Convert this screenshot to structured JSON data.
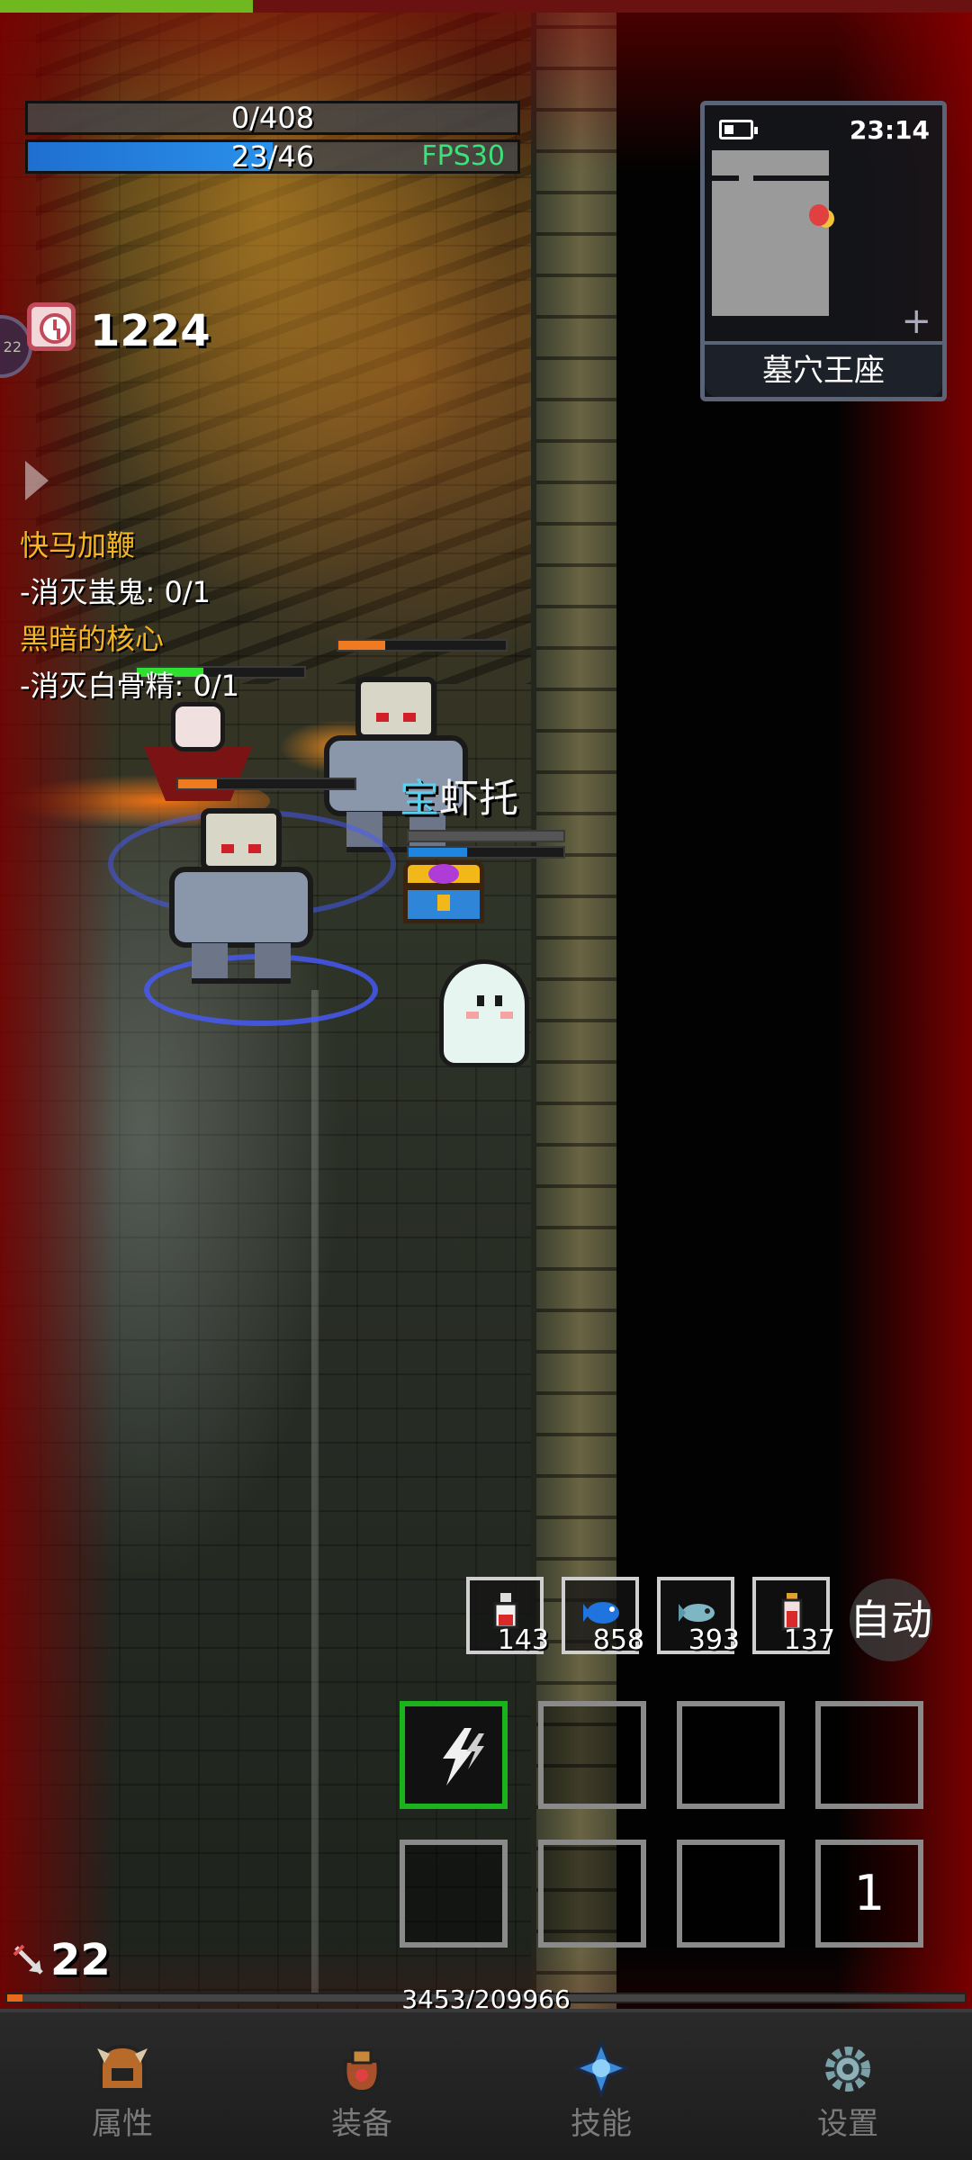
{
  "top_progress": {
    "fraction": 0.26,
    "color": "#6fb81f"
  },
  "hp": {
    "text": "0/408",
    "fraction": 0.0
  },
  "mp": {
    "text": "23/46",
    "fraction": 0.5
  },
  "fps": "FPS30",
  "timer": {
    "value": "1224",
    "icon": "clock-icon"
  },
  "quests": [
    {
      "title": "快马加鞭",
      "task": "-消灭蚩鬼: 0/1"
    },
    {
      "title": "黑暗的核心",
      "task": "-消灭白骨精: 0/1"
    }
  ],
  "minimap": {
    "time": "23:14",
    "area_name": "墓穴王座",
    "battery_icon": "battery-icon",
    "expand_icon": "plus-icon"
  },
  "pet_name": {
    "prefix": "宝",
    "name": "虾托"
  },
  "consumables": [
    {
      "icon": "potion-icon",
      "count": "143"
    },
    {
      "icon": "blue-fish-icon",
      "count": "858"
    },
    {
      "icon": "fish-icon",
      "count": "393"
    },
    {
      "icon": "red-potion-icon",
      "count": "137"
    }
  ],
  "auto_button": "自动",
  "skills": [
    {
      "icon": "lightning-bolt-icon",
      "active": true,
      "count": ""
    },
    {
      "icon": "",
      "active": false,
      "count": ""
    },
    {
      "icon": "",
      "active": false,
      "count": ""
    },
    {
      "icon": "",
      "active": false,
      "count": ""
    },
    {
      "icon": "",
      "active": false,
      "count": ""
    },
    {
      "icon": "",
      "active": false,
      "count": ""
    },
    {
      "icon": "",
      "active": false,
      "count": ""
    },
    {
      "icon": "",
      "active": false,
      "count": "1"
    }
  ],
  "arrows": {
    "icon": "arrow-icon",
    "count": "22"
  },
  "experience": {
    "text": "3453/209966",
    "fraction": 0.016
  },
  "nav": [
    {
      "icon": "helmet-icon",
      "label": "属性"
    },
    {
      "icon": "bag-icon",
      "label": "装备"
    },
    {
      "icon": "skill-gem-icon",
      "label": "技能"
    },
    {
      "icon": "gear-icon",
      "label": "设置"
    }
  ],
  "colors": {
    "hp_fill": "#5a5a5a",
    "mp_fill": "#1f86e0",
    "quest_title": "#f5b623",
    "skill_active": "#1bb31b",
    "xp_fill": "#e86a1a"
  }
}
